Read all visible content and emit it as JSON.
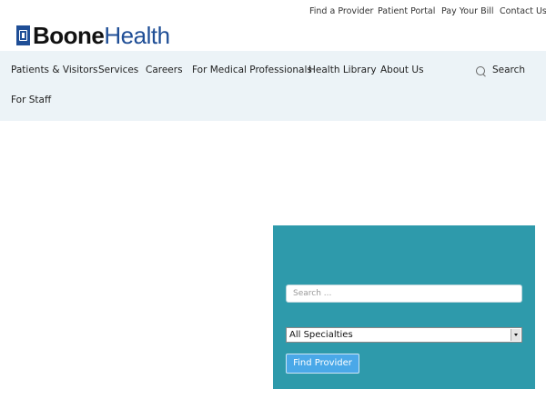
{
  "utility_nav": [
    "Find a Provider",
    "Patient Portal",
    "Pay Your Bill",
    "Contact Us"
  ],
  "logo": {
    "text_bold": "Boone",
    "text_regular": "Health",
    "brand_color": "#1f4e96"
  },
  "main_nav": {
    "items": [
      "Patients & Visitors",
      "Services",
      "Careers",
      "For Medical Professionals",
      "Health Library",
      "About Us",
      "For Staff"
    ],
    "search_label": "Search",
    "background": "#ecf3f7"
  },
  "provider_finder": {
    "search_placeholder": "Search ...",
    "specialty_selected": "All Specialties",
    "button_label": "Find Provider",
    "panel_color": "#2e9aab",
    "button_color": "#4aa8e8"
  }
}
